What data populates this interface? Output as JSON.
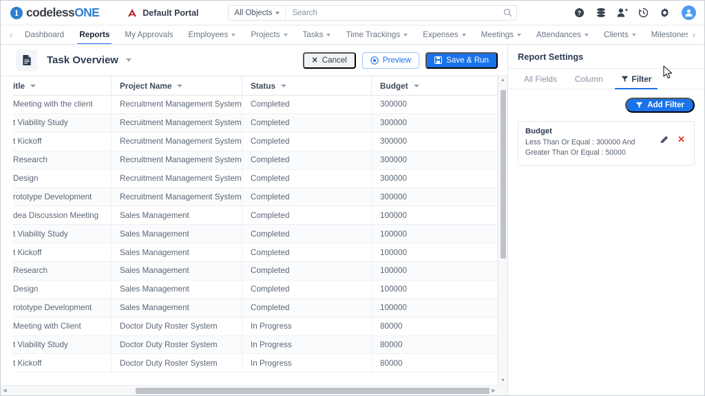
{
  "header": {
    "brand_part1": "codeless",
    "brand_part2": "ONE",
    "brand_mark": "1",
    "portal_label": "Default Portal",
    "portal_icon": "portal-logo-icon",
    "search_scope": "All Objects",
    "search_placeholder": "Search",
    "search_value": "",
    "icons": [
      "help-icon",
      "database-icon",
      "add-user-icon",
      "history-icon",
      "settings-gear-icon",
      "user-avatar-icon"
    ],
    "accent_color": "#1a73e8",
    "brand_color": "#2f7fd1"
  },
  "nav": {
    "prev_label": "‹",
    "next_label": "›",
    "items": [
      {
        "label": "Dashboard",
        "dropdown": false,
        "active": false
      },
      {
        "label": "Reports",
        "dropdown": false,
        "active": true
      },
      {
        "label": "My Approvals",
        "dropdown": false,
        "active": false
      },
      {
        "label": "Employees",
        "dropdown": true,
        "active": false
      },
      {
        "label": "Projects",
        "dropdown": true,
        "active": false
      },
      {
        "label": "Tasks",
        "dropdown": true,
        "active": false
      },
      {
        "label": "Time Trackings",
        "dropdown": true,
        "active": false
      },
      {
        "label": "Expenses",
        "dropdown": true,
        "active": false
      },
      {
        "label": "Meetings",
        "dropdown": true,
        "active": false
      },
      {
        "label": "Attendances",
        "dropdown": true,
        "active": false
      },
      {
        "label": "Clients",
        "dropdown": true,
        "active": false
      },
      {
        "label": "Milestones",
        "dropdown": true,
        "active": false
      }
    ]
  },
  "toolbar": {
    "doc_icon": "report-document-icon",
    "title": "Task Overview",
    "cancel_label": "Cancel",
    "preview_label": "Preview",
    "save_run_label": "Save & Run"
  },
  "table": {
    "columns": [
      {
        "label": "itle",
        "full_label": "Title",
        "sortable": true
      },
      {
        "label": "Project Name",
        "sortable": true
      },
      {
        "label": "Status",
        "sortable": true
      },
      {
        "label": "Budget",
        "sortable": true
      }
    ],
    "rows": [
      [
        "Meeting with the client",
        "Recruitment Management System",
        "Completed",
        "300000"
      ],
      [
        "t Viability Study",
        "Recruitment Management System",
        "Completed",
        "300000"
      ],
      [
        "t Kickoff",
        "Recruitment Management System",
        "Completed",
        "300000"
      ],
      [
        "Research",
        "Recruitment Management System",
        "Completed",
        "300000"
      ],
      [
        "Design",
        "Recruitment Management System",
        "Completed",
        "300000"
      ],
      [
        "rototype Development",
        "Recruitment Management System",
        "Completed",
        "300000"
      ],
      [
        "dea Discussion Meeting",
        "Sales Management",
        "Completed",
        "100000"
      ],
      [
        "t Viability Study",
        "Sales Management",
        "Completed",
        "100000"
      ],
      [
        "t Kickoff",
        "Sales Management",
        "Completed",
        "100000"
      ],
      [
        "Research",
        "Sales Management",
        "Completed",
        "100000"
      ],
      [
        "Design",
        "Sales Management",
        "Completed",
        "100000"
      ],
      [
        "rototype Development",
        "Sales Management",
        "Completed",
        "100000"
      ],
      [
        "Meeting with Client",
        "Doctor Duty Roster System",
        "In Progress",
        "80000"
      ],
      [
        "t Viability Study",
        "Doctor Duty Roster System",
        "In Progress",
        "80000"
      ],
      [
        "t Kickoff",
        "Doctor Duty Roster System",
        "In Progress",
        "80000"
      ]
    ]
  },
  "report_settings": {
    "panel_title": "Report Settings",
    "tabs": [
      {
        "label": "All Fields",
        "icon": "",
        "active": false
      },
      {
        "label": "Column",
        "icon": "",
        "active": false
      },
      {
        "label": "Filter",
        "icon": "filter-funnel-icon",
        "active": true
      }
    ],
    "add_filter_label": "Add Filter",
    "filters": [
      {
        "field": "Budget",
        "condition_line1": "Less Than Or Equal : 300000   And",
        "condition_line2": "Greater Than Or Equal : 50000",
        "edit_icon": "pencil-edit-icon",
        "delete_icon": "delete-x-icon",
        "delete_color": "#e53935"
      }
    ]
  }
}
